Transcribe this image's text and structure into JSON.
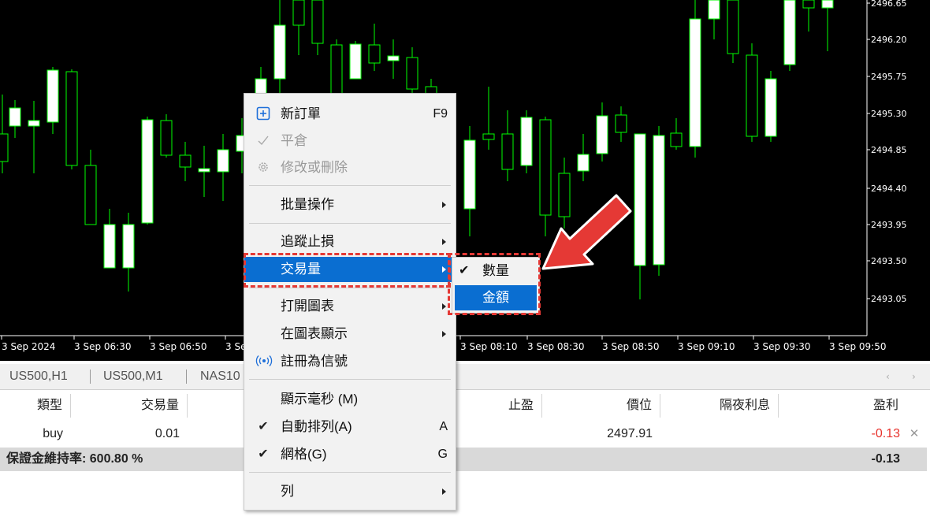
{
  "chart": {
    "price_ticks": [
      "2496.65",
      "2496.20",
      "2495.75",
      "2495.30",
      "2494.85",
      "2494.40",
      "2493.95",
      "2493.50",
      "2493.05"
    ],
    "time_ticks": [
      "3 Sep 2024",
      "3 Sep 06:30",
      "3 Sep 06:50",
      "3 Se",
      "3 Sep 08:10",
      "3 Sep 08:30",
      "3 Sep 08:50",
      "3 Sep 09:10",
      "3 Sep 09:30",
      "3 Sep 09:50"
    ],
    "colors": {
      "background": "#000000",
      "candle": "#00ff00",
      "bull_body": "#ffffff",
      "bear_body": "#000000"
    }
  },
  "tabs": [
    "US500,H1",
    "US500,M1",
    "NAS10"
  ],
  "tab_scroll": [
    "‹",
    "›"
  ],
  "table": {
    "headers": [
      "類型",
      "交易量",
      "止盈",
      "價位",
      "隔夜利息",
      "盈利"
    ],
    "row": {
      "type": "buy",
      "volume": "0.01",
      "price": "2497.91",
      "profit": "-0.13",
      "close": "✕"
    },
    "summary": {
      "label": "保證金維持率: 600.80 %",
      "profit": "-0.13"
    }
  },
  "context_menu": {
    "new_order": "新訂單",
    "new_order_shortcut": "F9",
    "new_order_icon": "new-order-icon",
    "close": "平倉",
    "close_icon": "checkmark-icon",
    "modify": "修改或刪除",
    "modify_icon": "gear-icon",
    "bulk": "批量操作",
    "trailing": "追蹤止損",
    "volume": "交易量",
    "open_chart": "打開圖表",
    "show_on_chart": "在圖表顯示",
    "register_signal": "註冊為信號",
    "register_signal_icon": "signal-icon",
    "show_ms": "顯示毫秒 (M)",
    "auto_arrange": "自動排列(A)",
    "auto_arrange_shortcut": "A",
    "grid": "網格(G)",
    "grid_shortcut": "G",
    "columns": "列"
  },
  "submenu": {
    "quantity": "數量",
    "amount": "金額"
  },
  "accent": "#0a6ed1",
  "annotation_color": "#e53935"
}
